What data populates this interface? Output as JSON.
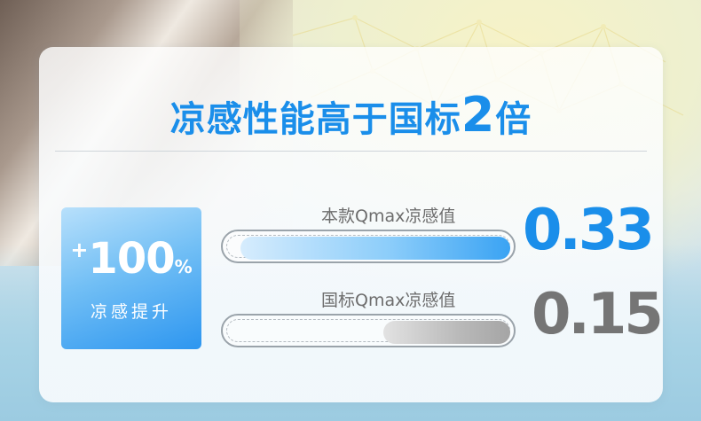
{
  "title": {
    "text": "凉感性能高于国标",
    "emphasis": "2",
    "suffix": "倍"
  },
  "badge": {
    "plus": "+",
    "number": "100",
    "sign": "%",
    "label": "凉感提升"
  },
  "rows": [
    {
      "label": "本款Qmax凉感值",
      "value": "0.33",
      "fill_fraction": 1.0
    },
    {
      "label": "国标Qmax凉感值",
      "value": "0.15",
      "fill_fraction": 0.47
    }
  ],
  "colors": {
    "accent": "#1a8eea",
    "gray_value": "#757575"
  }
}
